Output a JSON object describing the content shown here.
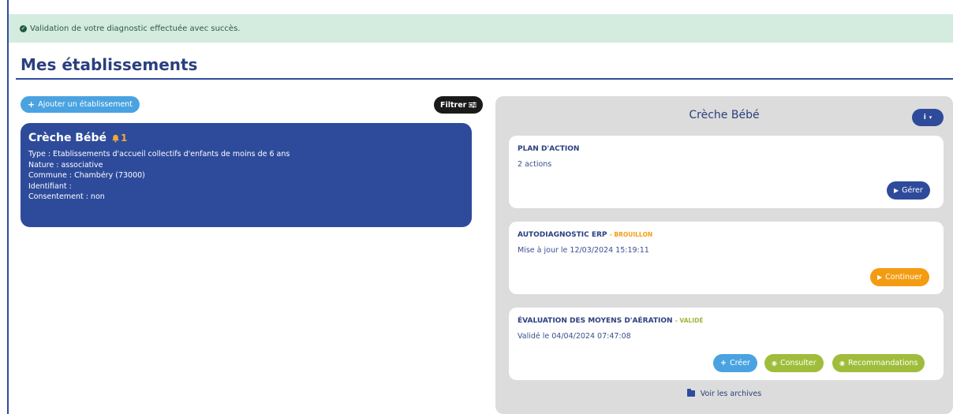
{
  "alert": {
    "icon": "check-circle-icon",
    "text": "Validation de votre diagnostic effectuée avec succès."
  },
  "page": {
    "title": "Mes établissements"
  },
  "toolbar": {
    "add_label": "Ajouter un établissement",
    "filter_label": "Filtrer"
  },
  "establishment": {
    "name": "Crèche Bébé",
    "alert_count": "1",
    "details": [
      "Type : Etablissements d'accueil collectifs d'enfants de moins de 6 ans",
      "Nature : associative",
      "Commune : Chambéry (73000)",
      "Identifiant :",
      "Consentement : non"
    ]
  },
  "panel": {
    "title": "Crèche Bébé",
    "info_label": "i",
    "cards": [
      {
        "title": "PLAN D'ACTION",
        "status": "",
        "text": "2 actions",
        "buttons": [
          "Gérer"
        ]
      },
      {
        "title": "AUTODIAGNOSTIC ERP",
        "status": "BROUILLON",
        "text": "Mise à jour le 12/03/2024 15:19:11",
        "buttons": [
          "Continuer"
        ]
      },
      {
        "title": "ÉVALUATION DES MOYENS D'AÉRATION",
        "status": "VALIDÉ",
        "text": "Validé le 04/04/2024 07:47:08",
        "buttons": [
          "Créer",
          "Consulter",
          "Recommandations"
        ]
      }
    ],
    "archives_label": "Voir les archives"
  },
  "colors": {
    "primary": "#2e4b9b",
    "accent_blue": "#4aa3e0",
    "orange": "#f39c12",
    "green": "#9fbd3b",
    "alert_bg": "#d4ebe0",
    "panel_bg": "#dcdcdc"
  }
}
